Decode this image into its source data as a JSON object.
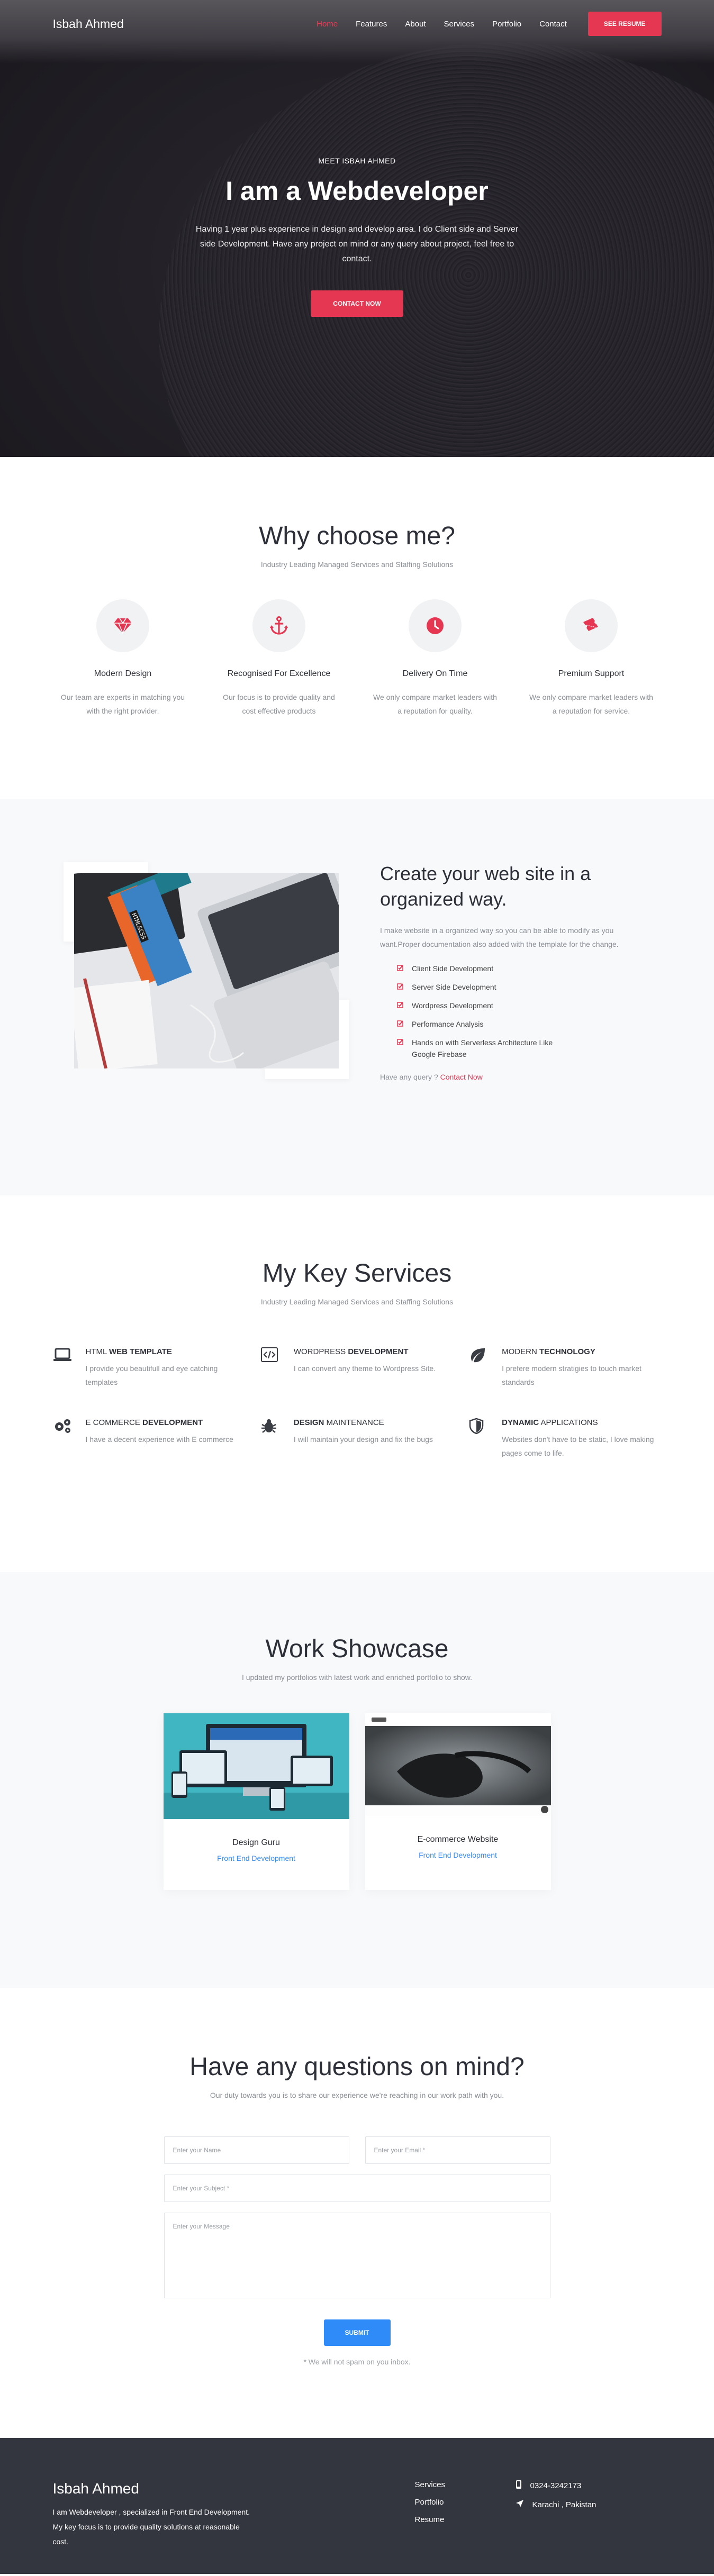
{
  "nav": {
    "brand": "Isbah Ahmed",
    "links": [
      "Home",
      "Features",
      "About",
      "Services",
      "Portfolio",
      "Contact"
    ],
    "resume_button": "SEE RESUME"
  },
  "hero": {
    "kicker": "MEET ISBAH AHMED",
    "title": "I am a Webdeveloper",
    "text": "Having 1 year plus experience in design and develop area. I do Client side and Server side Development. Have any project on mind or any query about project, feel free to contact.",
    "button": "CONTACT NOW"
  },
  "why": {
    "title": "Why choose me?",
    "subtitle": "Industry Leading Managed Services and Staffing Solutions",
    "items": [
      {
        "icon": "diamond-icon",
        "title": "Modern Design",
        "text": "Our team are experts in matching you with the right provider."
      },
      {
        "icon": "anchor-icon",
        "title": "Recognised For Excellence",
        "text": "Our focus is to provide quality and cost effective products"
      },
      {
        "icon": "clock-icon",
        "title": "Delivery On Time",
        "text": "We only compare market leaders with a reputation for quality."
      },
      {
        "icon": "ticket-icon",
        "title": "Premium Support",
        "text": "We only compare market leaders with a reputation for service."
      }
    ]
  },
  "create": {
    "title": "Create your web site in a organized way.",
    "text": "I make website in a organized way so you can be able to modify as you want.Proper documentation also added with the template for the change.",
    "list": [
      "Client Side Development",
      "Server Side Development",
      "Wordpress Development",
      "Performance Analysis",
      "Hands on with Serverless Architecture Like Google Firebase"
    ],
    "query_text": "Have any query ?",
    "query_link": "Contact Now",
    "book_label": "HTML&CSS"
  },
  "services": {
    "title": "My Key Services",
    "subtitle": "Industry Leading Managed Services and Staffing Solutions",
    "items": [
      {
        "icon": "laptop-icon",
        "light": "HTML ",
        "bold": "WEB TEMPLATE",
        "text": "I provide you beautifull and eye catching templates"
      },
      {
        "icon": "code-icon",
        "light": "WORDPRESS ",
        "bold": "DEVELOPMENT",
        "text": "I can convert any theme to Wordpress Site."
      },
      {
        "icon": "leaf-icon",
        "light": "MODERN ",
        "bold": "TECHNOLOGY",
        "text": "I prefere modern stratigies to touch market standards"
      },
      {
        "icon": "gears-icon",
        "light": "E COMMERCE ",
        "bold": "DEVELOPMENT",
        "text": "I have a decent experience with E commerce"
      },
      {
        "icon": "bug-icon",
        "light": "",
        "bold": "DESIGN",
        "light2": " MAINTENANCE",
        "text": "I will maintain your design and fix the bugs"
      },
      {
        "icon": "shield-icon",
        "light": "",
        "bold": "DYNAMIC",
        "light2": " APPLICATIONS",
        "text": "Websites don't have to be static, I love making pages come to life."
      }
    ]
  },
  "showcase": {
    "title": "Work Showcase",
    "subtitle": "I updated my portfolios with latest work and enriched portfolio to show.",
    "items": [
      {
        "title": "Design Guru",
        "category": "Front End Development"
      },
      {
        "title": "E-commerce Website",
        "category": "Front End Development"
      }
    ]
  },
  "contact": {
    "title": "Have any questions on mind?",
    "subtitle": "Our duty towards you is to share our experience we're reaching in our work path with you.",
    "name_placeholder": "Enter your Name",
    "email_placeholder": "Enter your Email *",
    "subject_placeholder": "Enter your Subject *",
    "message_placeholder": "Enter your Message",
    "submit": "SUBMIT",
    "spam_note": "* We will not spam on you inbox."
  },
  "footer": {
    "name": "Isbah Ahmed",
    "about": "I am Webdeveloper , specialized in Front End Development. My key focus is to provide quality solutions at reasonable cost.",
    "links": [
      "Services",
      "Portfolio",
      "Resume"
    ],
    "phone": "0324-3242173",
    "location": "Karachi , Pakistan"
  },
  "colors": {
    "accent_red": "#e53652",
    "accent_blue": "#2e8bf7",
    "footer_bg": "#33363f"
  }
}
